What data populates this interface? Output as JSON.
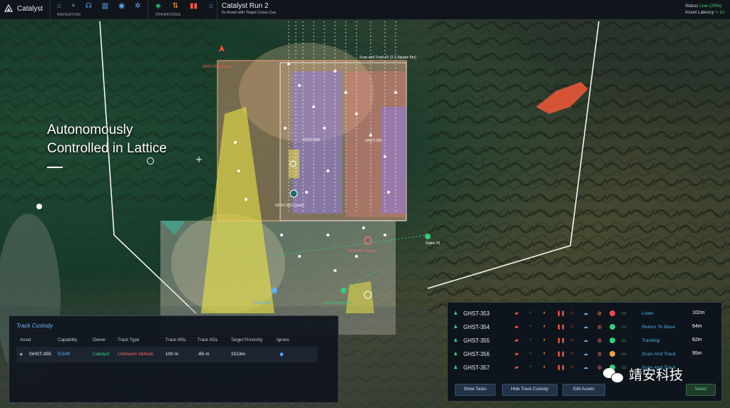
{
  "app": {
    "name": "Catalyst"
  },
  "nav": {
    "label": "NAVIGATION",
    "icons": [
      "home-icon",
      "plus-icon",
      "headset-icon",
      "bar-chart-icon",
      "eye-icon",
      "gear-icon"
    ]
  },
  "operations": {
    "label": "OPERATIONS",
    "icons": [
      "map-icon",
      "flight-icon",
      "pause-icon",
      "home-icon"
    ]
  },
  "run": {
    "title": "Catalyst Run 2",
    "subtitle": "5x Asset with Target Cross Cue"
  },
  "status": {
    "status_label": "Status",
    "status_value": "Live (20%)",
    "latency_label": "Asset Latency",
    "latency_value": "< 1s"
  },
  "headline": {
    "line1": "Autonomously",
    "line2": "Controlled in Lattice"
  },
  "map": {
    "area_label": "Scan and Track #1 (2.1 Square Km)",
    "labels": [
      "GHST-355 (Scan)",
      "GHST-356",
      "GHST-354",
      "GHST-356 (Loiter)",
      "GHST-357 (Scan)",
      "Gates #2",
      "GHST-353",
      "GHST-354 (Patrol)"
    ]
  },
  "track_custody": {
    "title": "Track Custody",
    "columns": [
      "Asset",
      "Capability",
      "Owner",
      "Track Type",
      "Track MSL",
      "Track AGL",
      "Target Proximity",
      "Ignore"
    ],
    "row": {
      "asset": "GHST-355",
      "capability": "EO/IR",
      "owner": "Catalyst",
      "track_type": "Unknown Vehicle",
      "msl": "100 m",
      "agl": "-65 m",
      "proximity": "1513m"
    }
  },
  "assets": [
    {
      "name": "GHST-353",
      "task": "Loiter",
      "distance": "102m",
      "status_color": "#e84a4a"
    },
    {
      "name": "GHST-354",
      "task": "Return To Base",
      "distance": "64m",
      "status_color": "#2fd07a"
    },
    {
      "name": "GHST-355",
      "task": "Tracking",
      "distance": "62m",
      "status_color": "#2fd07a"
    },
    {
      "name": "GHST-356",
      "task": "Scan And Track",
      "distance": "95m",
      "status_color": "#f5a142"
    },
    {
      "name": "GHST-357",
      "task": "Scan And Track",
      "distance": "",
      "status_color": "#2fd07a"
    }
  ],
  "asset_buttons": {
    "show_tasks": "Show Tasks",
    "hide_custody": "Hide Track Custody",
    "edit_assets": "Edit Assets",
    "select": "Select"
  },
  "watermark": {
    "text": "靖安科技"
  },
  "colors": {
    "accent": "#5ab0ff",
    "live": "#45d36a",
    "alert": "#ff5a3a"
  }
}
